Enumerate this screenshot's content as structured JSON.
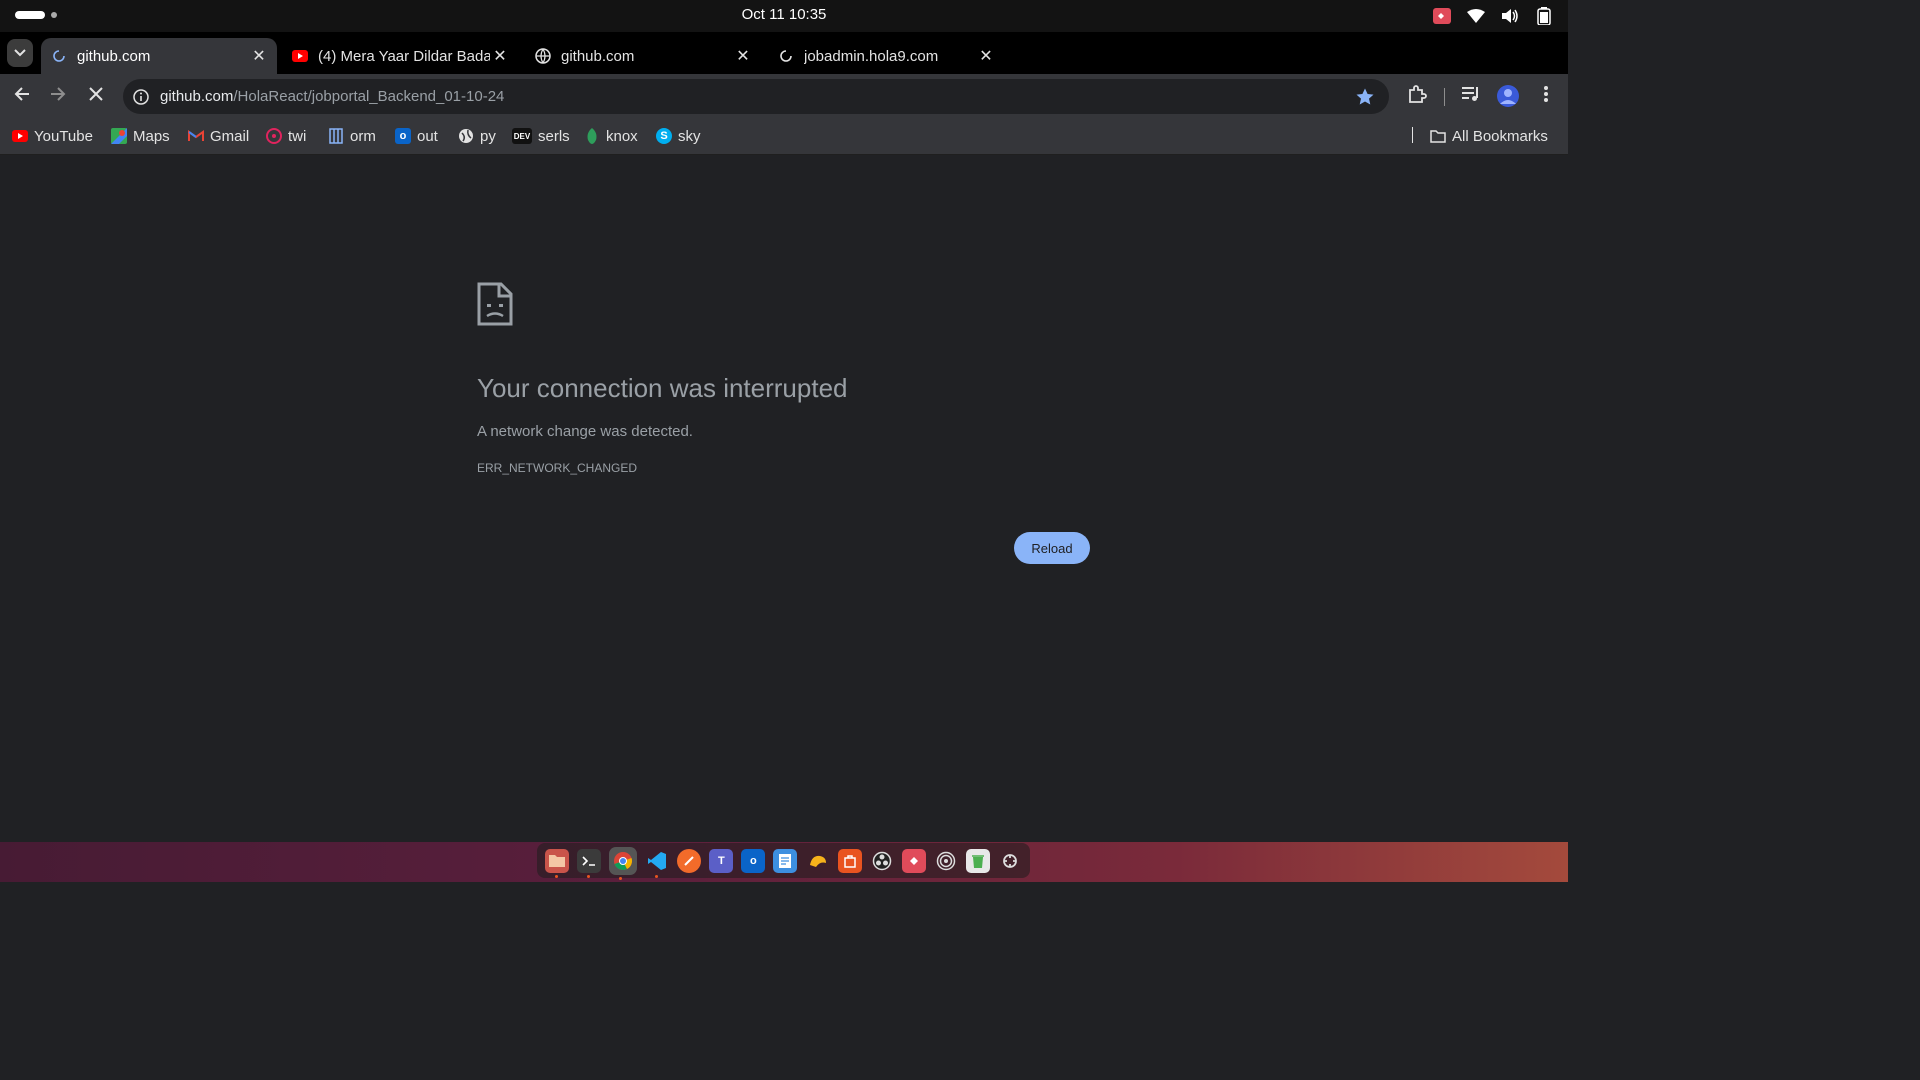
{
  "system_bar": {
    "datetime": "Oct 11  10:35"
  },
  "tabs": [
    {
      "title": "github.com",
      "favicon": "loading-spinner-icon",
      "active": true
    },
    {
      "title": "(4) Mera Yaar Dildar Bada",
      "favicon": "youtube-icon",
      "active": false
    },
    {
      "title": "github.com",
      "favicon": "globe-icon",
      "active": false
    },
    {
      "title": "jobadmin.hola9.com",
      "favicon": "loading-spinner-icon",
      "active": false
    }
  ],
  "tab_close_glyph": "✕",
  "new_tab_glyph": "+",
  "omnibox": {
    "host": "github.com",
    "path": "/HolaReact/jobportal_Backend_01-10-24",
    "bookmarked": true
  },
  "bookmarks": [
    {
      "label": "YouTube",
      "icon": "youtube-icon"
    },
    {
      "label": "Maps",
      "icon": "maps-icon"
    },
    {
      "label": "Gmail",
      "icon": "gmail-icon"
    },
    {
      "label": "twi",
      "icon": "twi-icon"
    },
    {
      "label": "orm",
      "icon": "orm-icon"
    },
    {
      "label": "out",
      "icon": "outlook-icon"
    },
    {
      "label": "py",
      "icon": "globe-icon"
    },
    {
      "label": "serls",
      "icon": "dev-icon"
    },
    {
      "label": "knox",
      "icon": "knox-icon"
    },
    {
      "label": "sky",
      "icon": "skype-icon"
    }
  ],
  "all_bookmarks_label": "All Bookmarks",
  "error_page": {
    "title": "Your connection was interrupted",
    "description": "A network change was detected.",
    "code": "ERR_NETWORK_CHANGED",
    "reload_label": "Reload"
  },
  "colors": {
    "page_bg": "#202124",
    "toolbar_bg": "#35363a",
    "accent_button": "#8ab4f8",
    "bookmark_star": "#8ab4f8"
  }
}
